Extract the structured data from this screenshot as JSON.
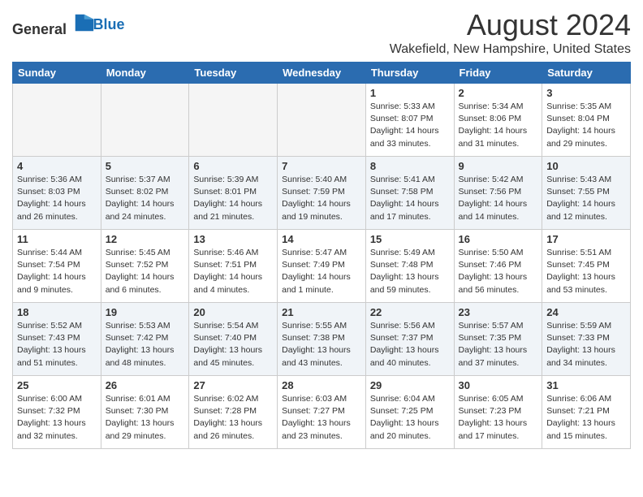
{
  "logo": {
    "general": "General",
    "blue": "Blue"
  },
  "title": "August 2024",
  "subtitle": "Wakefield, New Hampshire, United States",
  "days": [
    "Sunday",
    "Monday",
    "Tuesday",
    "Wednesday",
    "Thursday",
    "Friday",
    "Saturday"
  ],
  "weeks": [
    [
      {
        "date": "",
        "info": ""
      },
      {
        "date": "",
        "info": ""
      },
      {
        "date": "",
        "info": ""
      },
      {
        "date": "",
        "info": ""
      },
      {
        "date": "1",
        "info": "Sunrise: 5:33 AM\nSunset: 8:07 PM\nDaylight: 14 hours\nand 33 minutes."
      },
      {
        "date": "2",
        "info": "Sunrise: 5:34 AM\nSunset: 8:06 PM\nDaylight: 14 hours\nand 31 minutes."
      },
      {
        "date": "3",
        "info": "Sunrise: 5:35 AM\nSunset: 8:04 PM\nDaylight: 14 hours\nand 29 minutes."
      }
    ],
    [
      {
        "date": "4",
        "info": "Sunrise: 5:36 AM\nSunset: 8:03 PM\nDaylight: 14 hours\nand 26 minutes."
      },
      {
        "date": "5",
        "info": "Sunrise: 5:37 AM\nSunset: 8:02 PM\nDaylight: 14 hours\nand 24 minutes."
      },
      {
        "date": "6",
        "info": "Sunrise: 5:39 AM\nSunset: 8:01 PM\nDaylight: 14 hours\nand 21 minutes."
      },
      {
        "date": "7",
        "info": "Sunrise: 5:40 AM\nSunset: 7:59 PM\nDaylight: 14 hours\nand 19 minutes."
      },
      {
        "date": "8",
        "info": "Sunrise: 5:41 AM\nSunset: 7:58 PM\nDaylight: 14 hours\nand 17 minutes."
      },
      {
        "date": "9",
        "info": "Sunrise: 5:42 AM\nSunset: 7:56 PM\nDaylight: 14 hours\nand 14 minutes."
      },
      {
        "date": "10",
        "info": "Sunrise: 5:43 AM\nSunset: 7:55 PM\nDaylight: 14 hours\nand 12 minutes."
      }
    ],
    [
      {
        "date": "11",
        "info": "Sunrise: 5:44 AM\nSunset: 7:54 PM\nDaylight: 14 hours\nand 9 minutes."
      },
      {
        "date": "12",
        "info": "Sunrise: 5:45 AM\nSunset: 7:52 PM\nDaylight: 14 hours\nand 6 minutes."
      },
      {
        "date": "13",
        "info": "Sunrise: 5:46 AM\nSunset: 7:51 PM\nDaylight: 14 hours\nand 4 minutes."
      },
      {
        "date": "14",
        "info": "Sunrise: 5:47 AM\nSunset: 7:49 PM\nDaylight: 14 hours\nand 1 minute."
      },
      {
        "date": "15",
        "info": "Sunrise: 5:49 AM\nSunset: 7:48 PM\nDaylight: 13 hours\nand 59 minutes."
      },
      {
        "date": "16",
        "info": "Sunrise: 5:50 AM\nSunset: 7:46 PM\nDaylight: 13 hours\nand 56 minutes."
      },
      {
        "date": "17",
        "info": "Sunrise: 5:51 AM\nSunset: 7:45 PM\nDaylight: 13 hours\nand 53 minutes."
      }
    ],
    [
      {
        "date": "18",
        "info": "Sunrise: 5:52 AM\nSunset: 7:43 PM\nDaylight: 13 hours\nand 51 minutes."
      },
      {
        "date": "19",
        "info": "Sunrise: 5:53 AM\nSunset: 7:42 PM\nDaylight: 13 hours\nand 48 minutes."
      },
      {
        "date": "20",
        "info": "Sunrise: 5:54 AM\nSunset: 7:40 PM\nDaylight: 13 hours\nand 45 minutes."
      },
      {
        "date": "21",
        "info": "Sunrise: 5:55 AM\nSunset: 7:38 PM\nDaylight: 13 hours\nand 43 minutes."
      },
      {
        "date": "22",
        "info": "Sunrise: 5:56 AM\nSunset: 7:37 PM\nDaylight: 13 hours\nand 40 minutes."
      },
      {
        "date": "23",
        "info": "Sunrise: 5:57 AM\nSunset: 7:35 PM\nDaylight: 13 hours\nand 37 minutes."
      },
      {
        "date": "24",
        "info": "Sunrise: 5:59 AM\nSunset: 7:33 PM\nDaylight: 13 hours\nand 34 minutes."
      }
    ],
    [
      {
        "date": "25",
        "info": "Sunrise: 6:00 AM\nSunset: 7:32 PM\nDaylight: 13 hours\nand 32 minutes."
      },
      {
        "date": "26",
        "info": "Sunrise: 6:01 AM\nSunset: 7:30 PM\nDaylight: 13 hours\nand 29 minutes."
      },
      {
        "date": "27",
        "info": "Sunrise: 6:02 AM\nSunset: 7:28 PM\nDaylight: 13 hours\nand 26 minutes."
      },
      {
        "date": "28",
        "info": "Sunrise: 6:03 AM\nSunset: 7:27 PM\nDaylight: 13 hours\nand 23 minutes."
      },
      {
        "date": "29",
        "info": "Sunrise: 6:04 AM\nSunset: 7:25 PM\nDaylight: 13 hours\nand 20 minutes."
      },
      {
        "date": "30",
        "info": "Sunrise: 6:05 AM\nSunset: 7:23 PM\nDaylight: 13 hours\nand 17 minutes."
      },
      {
        "date": "31",
        "info": "Sunrise: 6:06 AM\nSunset: 7:21 PM\nDaylight: 13 hours\nand 15 minutes."
      }
    ]
  ]
}
